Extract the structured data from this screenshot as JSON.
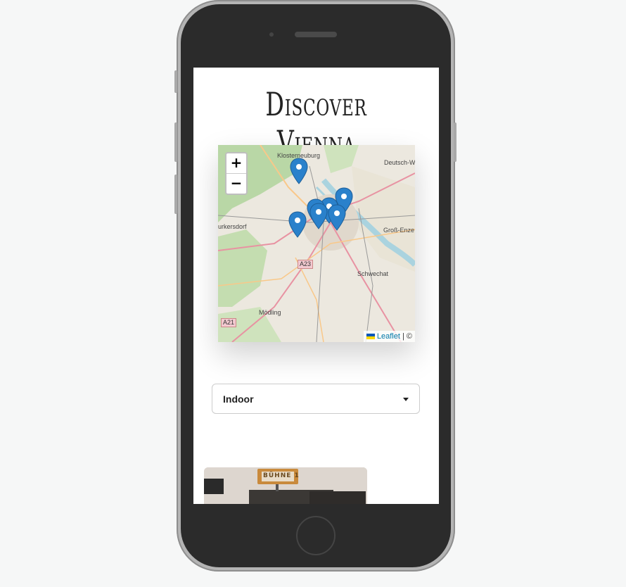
{
  "page": {
    "title": "Discover Vienna"
  },
  "map": {
    "zoom_in_label": "+",
    "zoom_out_label": "−",
    "attribution": {
      "link_label": "Leaflet",
      "separator": "|",
      "copyright": "©"
    },
    "place_labels": [
      "Klosterneuburg",
      "Deutsch-W",
      "urkersdorf",
      "Groß-Enze",
      "Schwechat",
      "Mödling",
      "A23",
      "A21"
    ],
    "marker_icon": "map-pin-icon",
    "marker_color": "#2a81cb"
  },
  "filter": {
    "selected": "Indoor"
  },
  "card": {
    "image_text": "BÜHNE 1"
  }
}
